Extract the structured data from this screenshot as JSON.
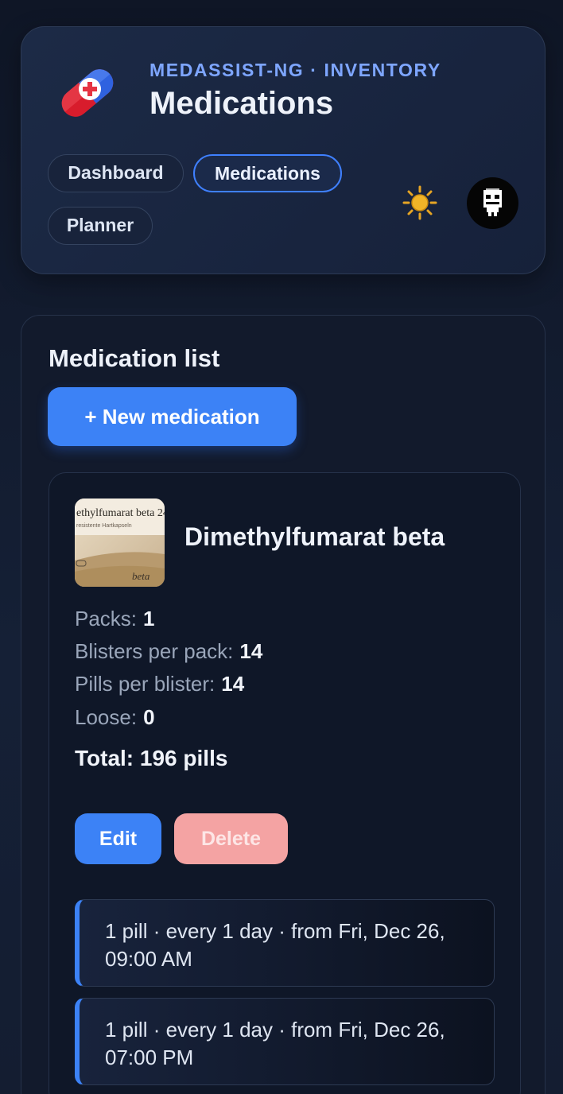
{
  "header": {
    "eyebrow": "MEDASSIST-NG · INVENTORY",
    "title": "Medications",
    "logo_icon": "pill-capsule-icon",
    "theme_icon": "sun-icon",
    "avatar_icon": "robot-avatar-icon"
  },
  "nav": {
    "items": [
      {
        "label": "Dashboard",
        "active": false
      },
      {
        "label": "Medications",
        "active": true
      },
      {
        "label": "Planner",
        "active": false
      }
    ]
  },
  "main": {
    "section_title": "Medication list",
    "new_button": "+ New medication"
  },
  "medication": {
    "name": "Dimethylfumarat beta",
    "thumbnail_text": "ethylfumarat beta 24",
    "thumbnail_subtext": "resistente Hartkapseln",
    "thumbnail_brand": "beta",
    "stats": [
      {
        "label": "Packs:",
        "value": "1"
      },
      {
        "label": "Blisters per pack:",
        "value": "14"
      },
      {
        "label": "Pills per blister:",
        "value": "14"
      },
      {
        "label": "Loose:",
        "value": "0"
      }
    ],
    "total": "Total: 196 pills",
    "edit_label": "Edit",
    "delete_label": "Delete",
    "schedules": [
      "1 pill · every 1 day · from Fri, Dec 26, 09:00 AM",
      "1 pill · every 1 day · from Fri, Dec 26, 07:00 PM"
    ]
  },
  "colors": {
    "accent": "#3c82f6",
    "eyebrow": "#7ea6ff",
    "danger_soft": "#f4a3a3",
    "background": "#121a2b"
  }
}
